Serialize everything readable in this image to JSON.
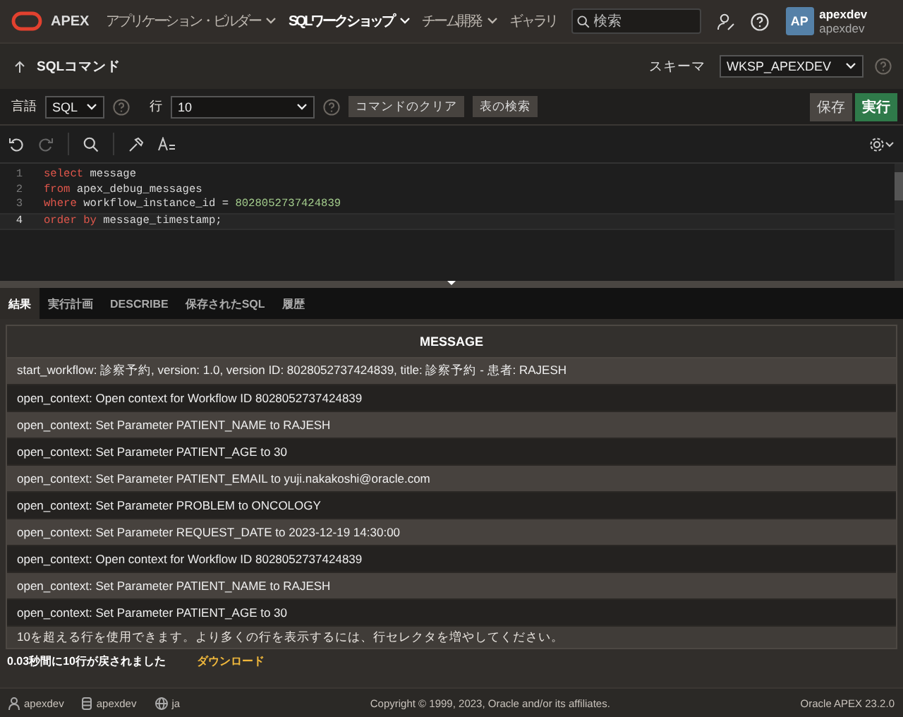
{
  "header": {
    "logo": "APEX",
    "nav": [
      {
        "label": "アプリケーション・ビルダー",
        "selected": false,
        "dropdown": true
      },
      {
        "label": "SQLワークショップ",
        "selected": true,
        "dropdown": true
      },
      {
        "label": "チーム開発",
        "selected": false,
        "dropdown": true
      },
      {
        "label": "ギャラリ",
        "selected": false,
        "dropdown": false
      }
    ],
    "search": {
      "placeholder": "検索"
    },
    "user": {
      "initials": "AP",
      "name": "apexdev",
      "workspace": "apexdev"
    }
  },
  "page": {
    "title": "SQLコマンド",
    "schema_label": "スキーマ",
    "schema": "WKSP_APEXDEV"
  },
  "toolbar": {
    "language_label": "言語",
    "language": "SQL",
    "rows_label": "行",
    "rows": "10",
    "buttons": [
      "コマンドのクリア",
      "表の検索"
    ],
    "save": "保存",
    "run": "実行"
  },
  "editor": {
    "lines": [
      {
        "number": "1",
        "selected": false,
        "tokens": [
          {
            "kind": "keyword",
            "text": "select"
          },
          {
            "kind": "plain",
            "text": " message"
          }
        ]
      },
      {
        "number": "2",
        "selected": false,
        "tokens": [
          {
            "kind": "keyword",
            "text": "from"
          },
          {
            "kind": "plain",
            "text": " apex_debug_messages"
          }
        ]
      },
      {
        "number": "3",
        "selected": false,
        "tokens": [
          {
            "kind": "keyword",
            "text": "where"
          },
          {
            "kind": "plain",
            "text": " workflow_instance_id = "
          },
          {
            "kind": "number",
            "text": "8028052737424839"
          }
        ]
      },
      {
        "number": "4",
        "selected": true,
        "tokens": [
          {
            "kind": "keyword",
            "text": "order by"
          },
          {
            "kind": "plain",
            "text": " message_timestamp;"
          }
        ]
      }
    ]
  },
  "tabs": [
    {
      "label": "結果",
      "selected": true
    },
    {
      "label": "実行計画",
      "selected": false
    },
    {
      "label": "DESCRIBE",
      "selected": false
    },
    {
      "label": "保存されたSQL",
      "selected": false
    },
    {
      "label": "履歴",
      "selected": false
    }
  ],
  "results": {
    "columns": [
      "MESSAGE"
    ],
    "rows": [
      "start_workflow: 診察予約, version: 1.0, version ID: 8028052737424839, title: 診察予約 - 患者: RAJESH",
      "open_context: Open context for Workflow ID 8028052737424839",
      "open_context: Set Parameter PATIENT_NAME to RAJESH",
      "open_context: Set Parameter PATIENT_AGE to 30",
      "open_context: Set Parameter PATIENT_EMAIL to yuji.nakakoshi@oracle.com",
      "open_context: Set Parameter PROBLEM to ONCOLOGY",
      "open_context: Set Parameter REQUEST_DATE to 2023-12-19 14:30:00",
      "open_context: Open context for Workflow ID 8028052737424839",
      "open_context: Set Parameter PATIENT_NAME to RAJESH",
      "open_context: Set Parameter PATIENT_AGE to 30"
    ],
    "notice": "10を超える行を使用できます。より多くの行を表示するには、行セレクタを増やしてください。",
    "summary": "0.03秒間に10行が戻されました",
    "download": "ダウンロード"
  },
  "footer": {
    "user": "apexdev",
    "workspace": "apexdev",
    "language": "ja",
    "copyright": "Copyright © 1999, 2023, Oracle and/or its affiliates.",
    "version": "Oracle APEX 23.2.0"
  }
}
